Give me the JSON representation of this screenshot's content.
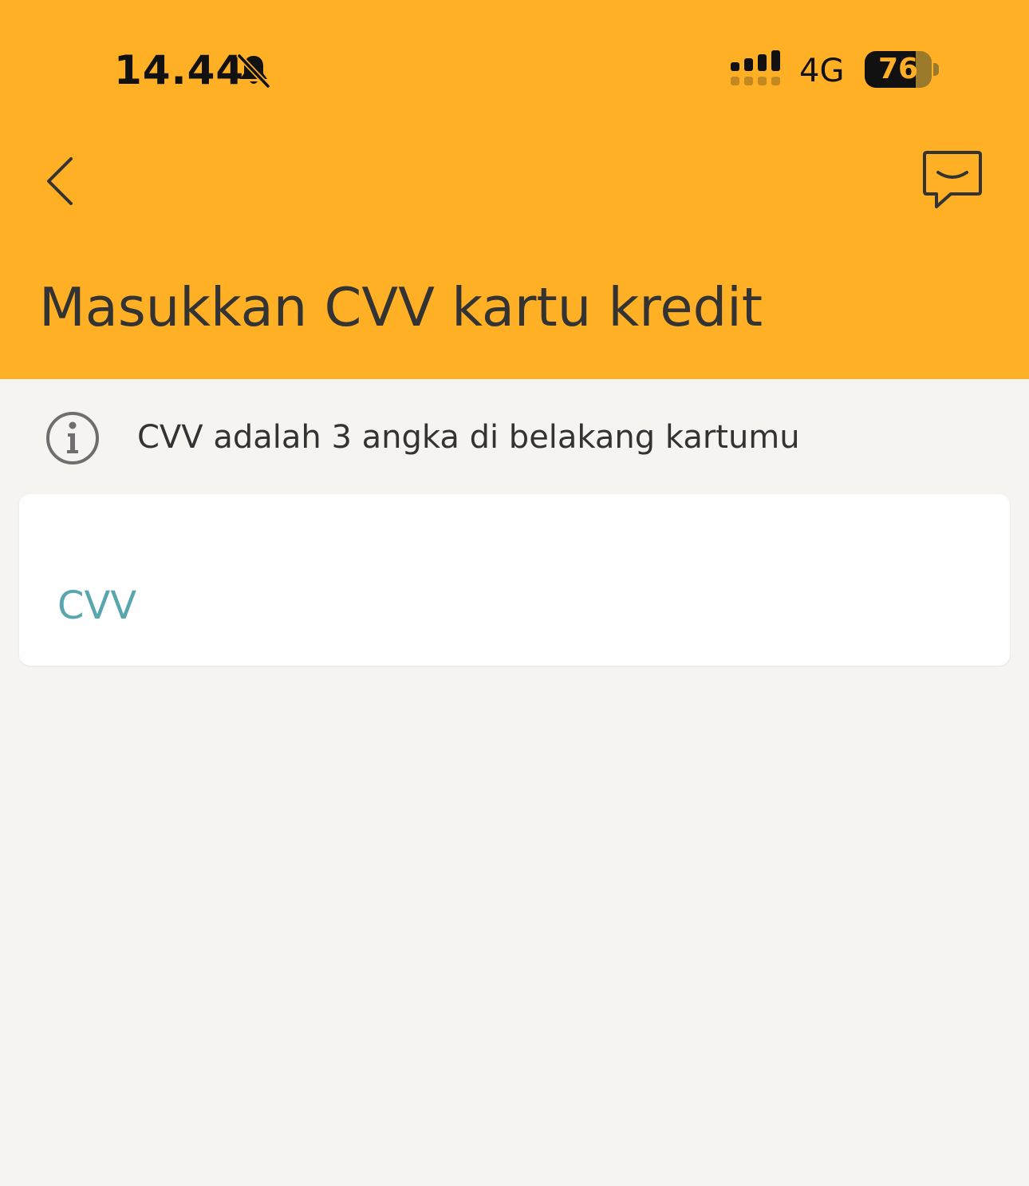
{
  "status_bar": {
    "time": "14.44",
    "network": "4G",
    "battery_level": "76",
    "battery_fraction": 0.76,
    "icons": [
      "bell-muted-icon",
      "signal-icon",
      "battery-icon"
    ]
  },
  "header": {
    "title": "Masukkan CVV kartu kredit",
    "background_color": "#FFB024",
    "back_icon": "chevron-left-icon",
    "chat_icon": "chat-bubble-icon"
  },
  "info": {
    "icon": "info-circle-icon",
    "text": "CVV adalah 3 angka di belakang kartumu"
  },
  "cvv_field": {
    "value": "",
    "placeholder": "CVV",
    "placeholder_color": "#5AA6AE"
  },
  "colors": {
    "page_background": "#F5F4F1",
    "text": "#333333"
  }
}
